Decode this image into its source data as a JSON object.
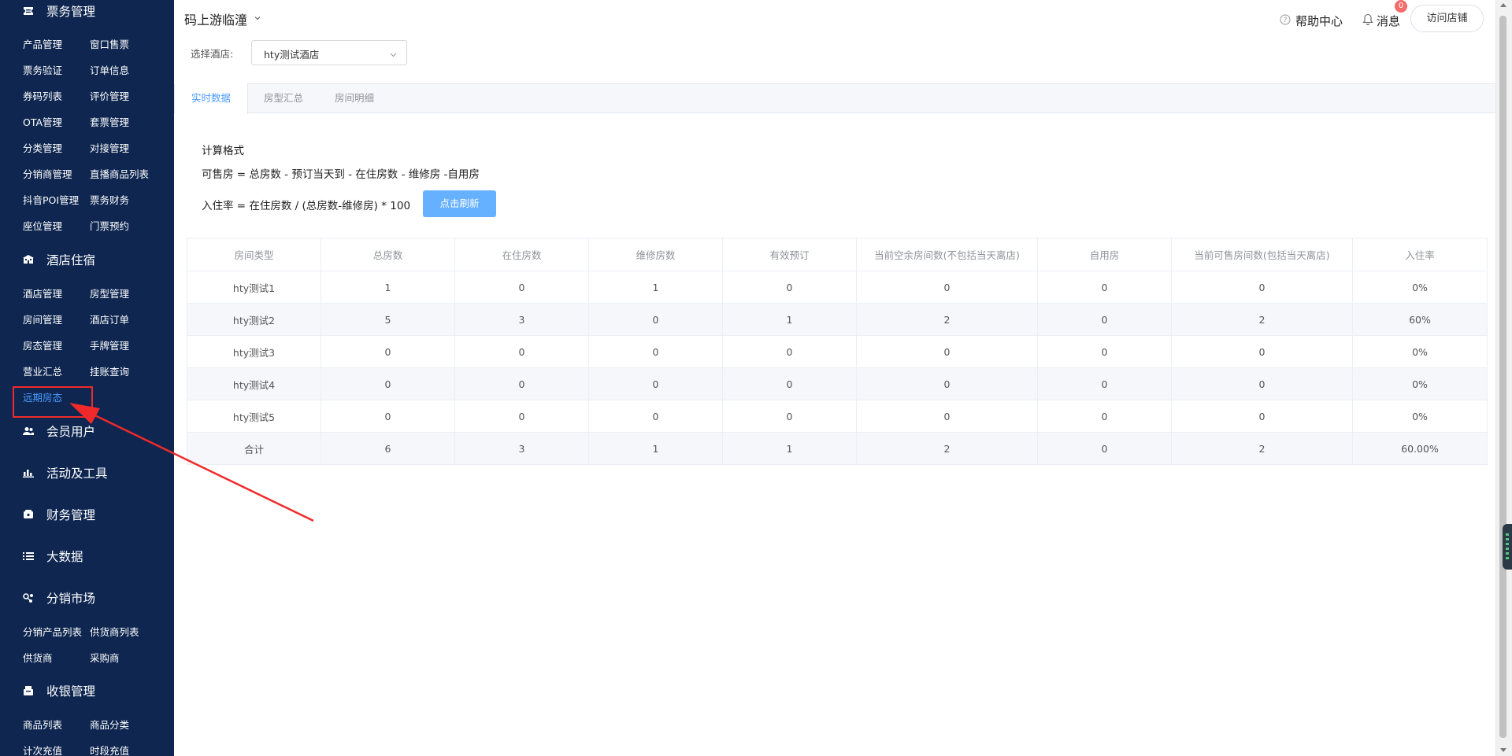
{
  "sidebar": {
    "sections": [
      {
        "label": "票务管理",
        "icon": "ticket-icon"
      },
      {
        "label": "酒店住宿",
        "icon": "hotel-icon"
      },
      {
        "label": "会员用户",
        "icon": "users-icon"
      },
      {
        "label": "活动及工具",
        "icon": "bar-chart-icon"
      },
      {
        "label": "财务管理",
        "icon": "wallet-icon"
      },
      {
        "label": "大数据",
        "icon": "list-icon"
      },
      {
        "label": "分销市场",
        "icon": "share-icon"
      },
      {
        "label": "收银管理",
        "icon": "cashier-icon"
      }
    ],
    "ticket_items": [
      "产品管理",
      "窗口售票",
      "票务验证",
      "订单信息",
      "券码列表",
      "评价管理",
      "OTA管理",
      "套票管理",
      "分类管理",
      "对接管理",
      "分销商管理",
      "直播商品列表",
      "抖音POI管理",
      "票务财务",
      "座位管理",
      "门票预约"
    ],
    "hotel_items": [
      "酒店管理",
      "房型管理",
      "房间管理",
      "酒店订单",
      "房态管理",
      "手牌管理",
      "营业汇总",
      "挂账查询",
      "远期房态"
    ],
    "dist_items": [
      "分销产品列表",
      "供货商列表",
      "供货商",
      "采购商"
    ],
    "cashier_items": [
      "商品列表",
      "商品分类",
      "计次充值",
      "时段充值"
    ],
    "active_item": "远期房态"
  },
  "header": {
    "store_name": "码上游临潼",
    "hotel_label": "选择酒店:",
    "hotel_value": "hty测试酒店",
    "help": "帮助中心",
    "messages": "消息",
    "message_count": "0",
    "visit_store": "访问店铺"
  },
  "tabs": [
    {
      "label": "实时数据",
      "active": true
    },
    {
      "label": "房型汇总",
      "active": false
    },
    {
      "label": "房间明细",
      "active": false
    }
  ],
  "calc": {
    "title": "计算格式",
    "formula1": "可售房 = 总房数 - 预订当天到 - 在住房数 - 维修房 -自用房",
    "formula2": "入住率 = 在住房数 / (总房数-维修房) * 100",
    "refresh": "点击刷新"
  },
  "table": {
    "columns": [
      "房间类型",
      "总房数",
      "在住房数",
      "维修房数",
      "有效预订",
      "当前空余房间数(不包括当天离店)",
      "自用房",
      "当前可售房间数(包括当天离店)",
      "入住率"
    ],
    "rows": [
      [
        "hty测试1",
        "1",
        "0",
        "1",
        "0",
        "0",
        "0",
        "0",
        "0%"
      ],
      [
        "hty测试2",
        "5",
        "3",
        "0",
        "1",
        "2",
        "0",
        "2",
        "60%"
      ],
      [
        "hty测试3",
        "0",
        "0",
        "0",
        "0",
        "0",
        "0",
        "0",
        "0%"
      ],
      [
        "hty测试4",
        "0",
        "0",
        "0",
        "0",
        "0",
        "0",
        "0",
        "0%"
      ],
      [
        "hty测试5",
        "0",
        "0",
        "0",
        "0",
        "0",
        "0",
        "0",
        "0%"
      ],
      [
        "合计",
        "6",
        "3",
        "1",
        "1",
        "2",
        "0",
        "2",
        "60.00%"
      ]
    ]
  },
  "colors": {
    "sidebar_bg": "#0e2650",
    "accent": "#4b9bff",
    "refresh_button": "#66b1ff",
    "annotation": "#f02a2a",
    "badge": "#f56c6c"
  }
}
